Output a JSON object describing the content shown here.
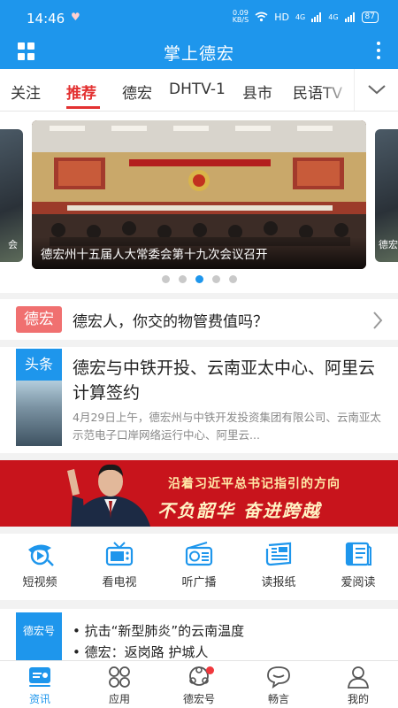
{
  "status_bar": {
    "time": "14:46",
    "net_speed_value": "0.09",
    "net_speed_unit": "KB/S",
    "hd_label": "HD",
    "network_1": "4G",
    "network_2": "4G",
    "battery": "87"
  },
  "header": {
    "title": "掌上德宏"
  },
  "tabs": [
    {
      "label": "关注"
    },
    {
      "label": "推荐",
      "active": true
    },
    {
      "label": "德宏"
    },
    {
      "label": "DHTV-1"
    },
    {
      "label": "县市"
    },
    {
      "label": "民语TV"
    }
  ],
  "carousel": {
    "caption": "德宏州十五届人大常委会第十九次会议召开",
    "left_peek_caption": "会",
    "right_peek_caption": "德宏",
    "slide_count": 5,
    "active_index": 2
  },
  "headline": {
    "badge": "德宏",
    "text": "德宏人，你交的物管费值吗？"
  },
  "top_news": {
    "tag": "头条",
    "title": "德宏与中铁开投、云南亚太中心、阿里云计算签约",
    "summary": "4月29日上午，德宏州与中铁开发投资集团有限公司、云南亚太示范电子口岸网络运行中心、阿里云..."
  },
  "banner": {
    "slogan_line1": "沿着习近平总书记指引的方向",
    "slogan_line2": "不负韶华  奋进跨越"
  },
  "quick_nav": [
    {
      "label": "短视频",
      "icon": "short-video-icon"
    },
    {
      "label": "看电视",
      "icon": "tv-icon"
    },
    {
      "label": "听广播",
      "icon": "radio-icon"
    },
    {
      "label": "读报纸",
      "icon": "newspaper-icon"
    },
    {
      "label": "爱阅读",
      "icon": "book-icon"
    }
  ],
  "dehong_hao": {
    "logo_text": "德宏号",
    "items": [
      "• 抗击“新型肺炎”的云南温度",
      "• 德宏：返岗路 护城人"
    ]
  },
  "bottom_nav": [
    {
      "label": "资讯",
      "icon": "news-icon",
      "active": true
    },
    {
      "label": "应用",
      "icon": "apps-icon"
    },
    {
      "label": "德宏号",
      "icon": "dehonghao-icon",
      "has_badge": true
    },
    {
      "label": "畅言",
      "icon": "chat-icon"
    },
    {
      "label": "我的",
      "icon": "profile-icon"
    }
  ],
  "colors": {
    "brand_blue": "#1e96ec",
    "accent_red": "#e33131",
    "badge_red": "#f07070",
    "banner_red": "#c8141c"
  }
}
